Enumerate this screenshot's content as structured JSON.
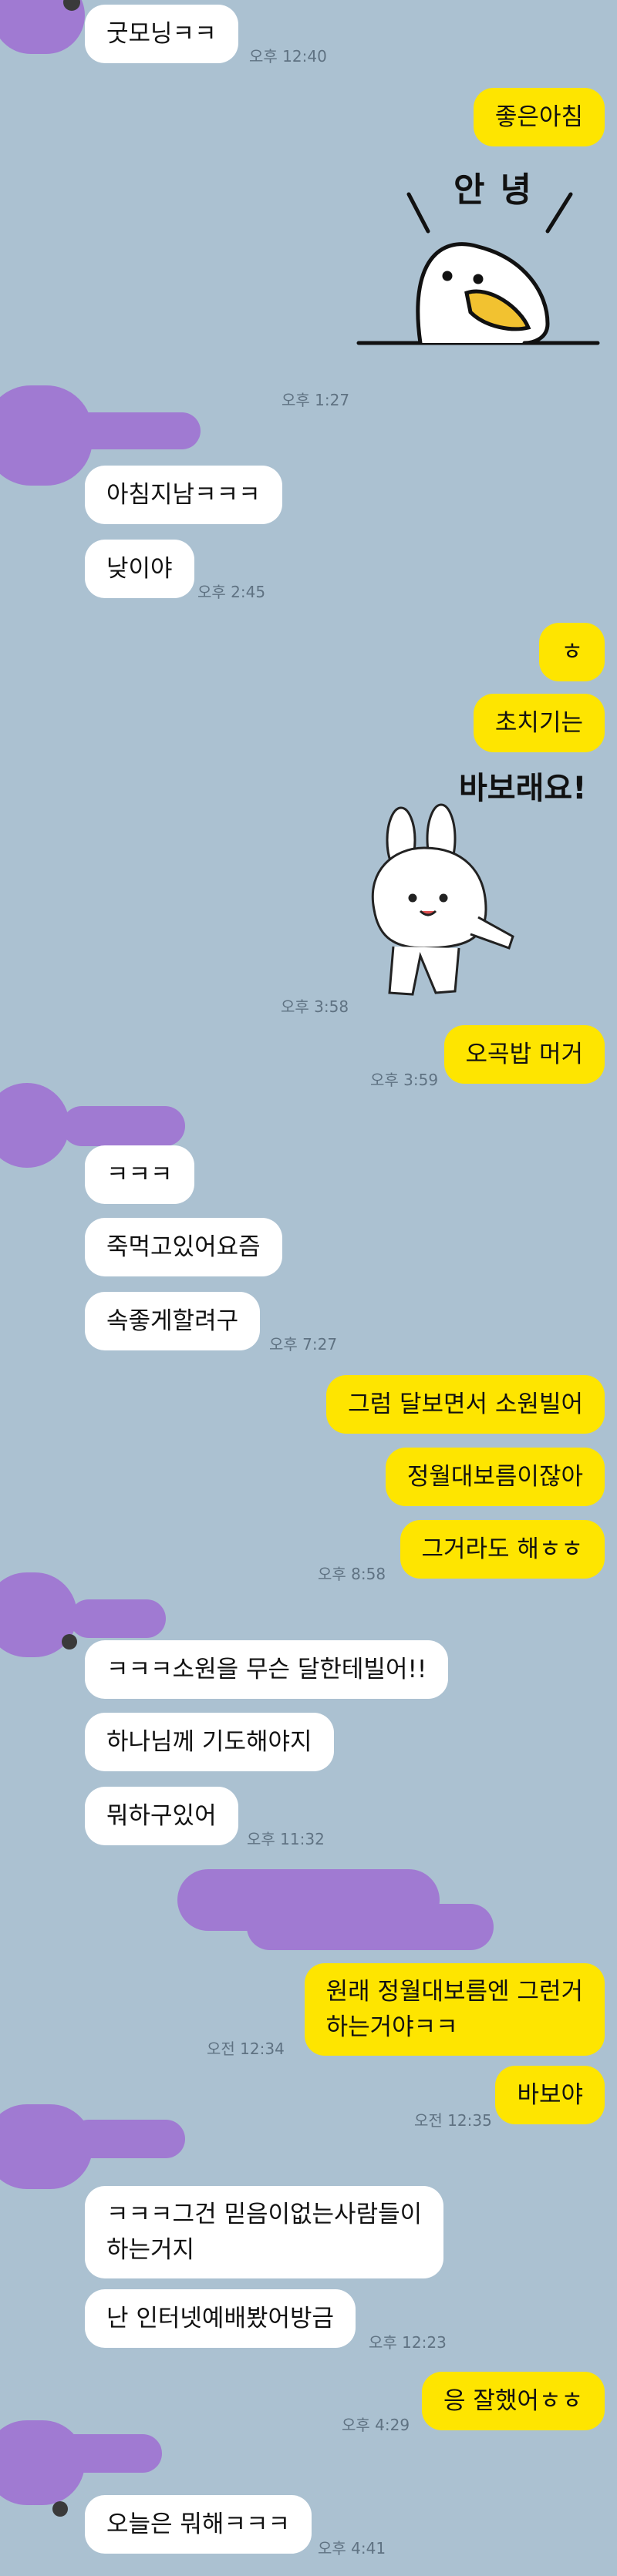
{
  "messages": [
    {
      "text": "굿모닝ㅋㅋ",
      "time": "오후 12:40"
    },
    {
      "text": "좋은아침"
    },
    {
      "sticker_text": "안녕",
      "time": "오후 1:27"
    },
    {
      "text": "아침지남ㅋㅋㅋ"
    },
    {
      "text": "낮이야",
      "time": "오후 2:45"
    },
    {
      "text": "ㅎ"
    },
    {
      "text": "초치기는"
    },
    {
      "sticker_text": "바보래요!",
      "time": "오후 3:58"
    },
    {
      "text": "오곡밥 머거",
      "time": "오후 3:59"
    },
    {
      "text": "ㅋㅋㅋ"
    },
    {
      "text": "죽먹고있어요즘"
    },
    {
      "text": "속좋게할려구",
      "time": "오후 7:27"
    },
    {
      "text": "그럼 달보면서 소원빌어"
    },
    {
      "text": "정월대보름이잖아"
    },
    {
      "text": "그거라도 해ㅎㅎ",
      "time": "오후 8:58"
    },
    {
      "text": "ㅋㅋㅋ소원을 무슨 달한테빌어!!"
    },
    {
      "text": "하나님께 기도해야지"
    },
    {
      "text": "뭐하구있어",
      "time": "오후 11:32"
    },
    {
      "line1": "원래 정월대보름엔 그런거",
      "line2": "하는거야ㅋㅋ",
      "time": "오전 12:34"
    },
    {
      "text": "바보야",
      "time": "오전 12:35"
    },
    {
      "line1": "ㅋㅋㅋ그건 믿음이없는사람들이",
      "line2": "하는거지"
    },
    {
      "text": "난 인터넷예배봤어방금",
      "time": "오후 12:23"
    },
    {
      "text": "응 잘했어ㅎㅎ",
      "time": "오후 4:29"
    },
    {
      "text": "오늘은 뭐해ㅋㅋㅋ",
      "time": "오후 4:41"
    }
  ]
}
